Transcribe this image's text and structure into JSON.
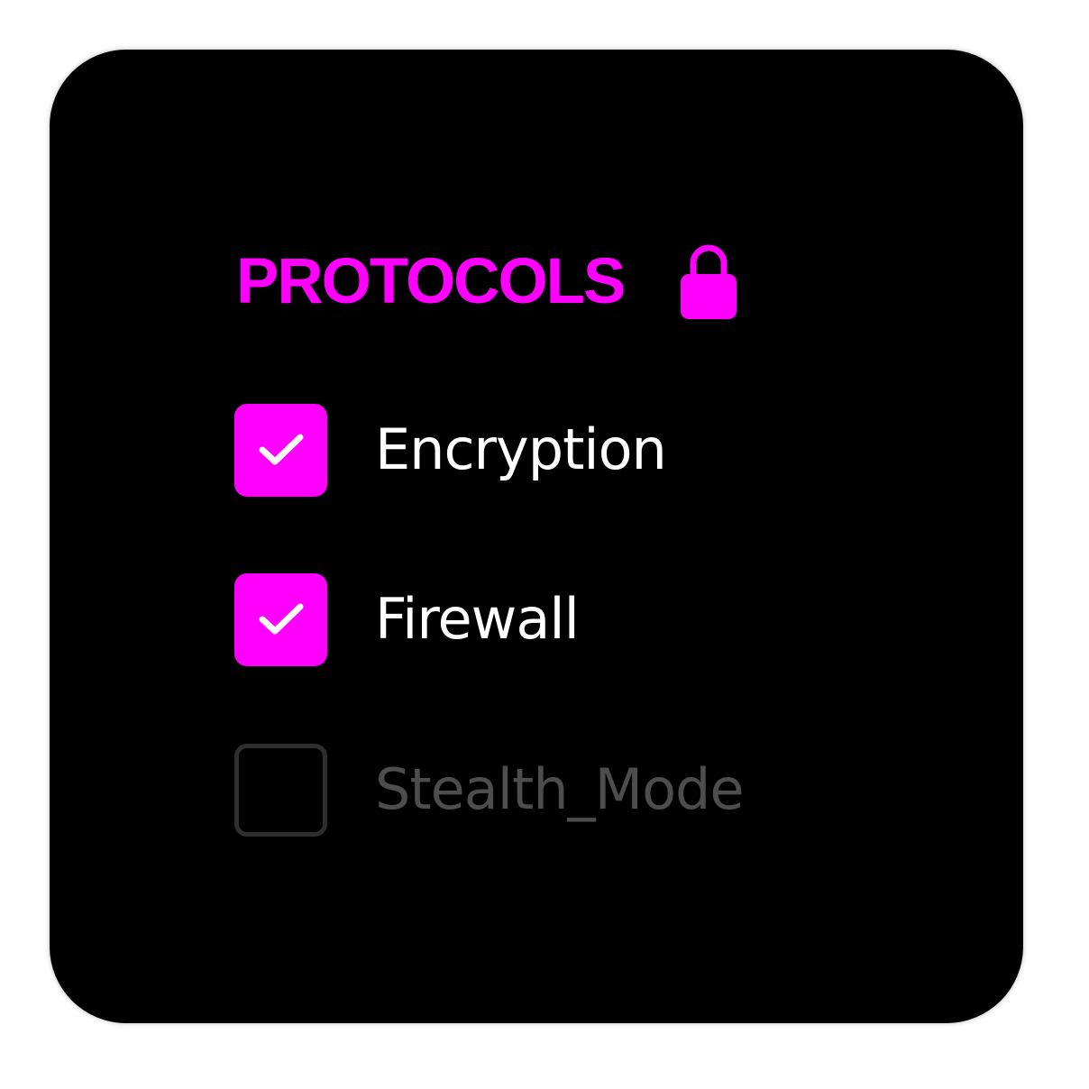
{
  "panel": {
    "title": "PROTOCOLS",
    "title_icon": "lock-icon",
    "accent_color": "#ff00ff",
    "options": [
      {
        "label": "Encryption",
        "checked": true
      },
      {
        "label": "Firewall",
        "checked": true
      },
      {
        "label": "Stealth_Mode",
        "checked": false
      }
    ]
  }
}
